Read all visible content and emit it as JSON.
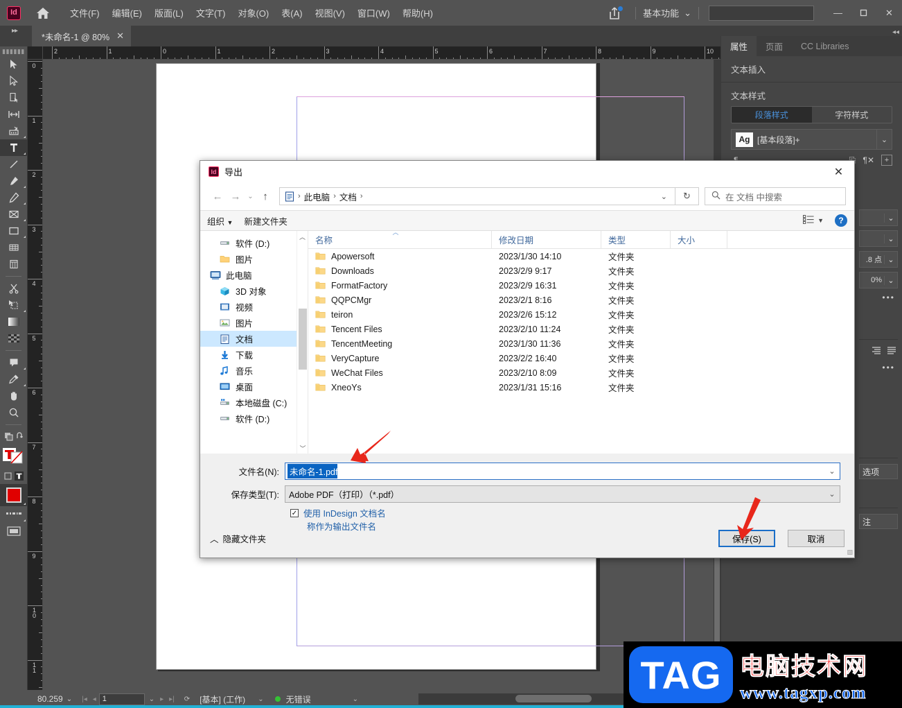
{
  "app": {
    "logo_text": "Id",
    "menus": [
      "文件(F)",
      "编辑(E)",
      "版面(L)",
      "文字(T)",
      "对象(O)",
      "表(A)",
      "视图(V)",
      "窗口(W)",
      "帮助(H)"
    ],
    "workspace": "基本功能",
    "window_controls": {
      "minimize": "—",
      "maximize": "❐",
      "close": "✕"
    },
    "tab": {
      "title": "*未命名-1 @ 80%",
      "close": "✕"
    }
  },
  "rulers": {
    "horizontal": [
      "2",
      "1",
      "0",
      "1",
      "2",
      "3",
      "4",
      "5",
      "6",
      "7",
      "8",
      "9",
      "10"
    ],
    "vertical": [
      "0",
      "1",
      "2",
      "3",
      "4",
      "5",
      "6",
      "7",
      "8",
      "9",
      "10",
      "11"
    ]
  },
  "right_dock": {
    "tabs": [
      {
        "label": "属性",
        "active": true
      },
      {
        "label": "页面",
        "active": false
      },
      {
        "label": "CC Libraries",
        "active": false
      }
    ],
    "section_text_insert": "文本插入",
    "section_text_style": "文本样式",
    "style_segments": [
      {
        "label": "段落样式",
        "active": true
      },
      {
        "label": "字符样式",
        "active": false
      }
    ],
    "style_swatch": "Ag",
    "style_name": "[基本段落]+",
    "stub_values": {
      "leading": ".8 点",
      "scale": "0%"
    },
    "stub_buttons": {
      "options": "选项",
      "notes": "注"
    },
    "dots": "•••"
  },
  "statusbar": {
    "zoom": "80.259",
    "page": "1",
    "master": "[基本]  (工作)",
    "errors": "无错误"
  },
  "dialog": {
    "title": "导出",
    "close": "✕",
    "nav": {
      "back": "←",
      "forward": "→",
      "recent": "⌄",
      "up": "↑"
    },
    "breadcrumbs": [
      "此电脑",
      "文档"
    ],
    "address_caret": "⌄",
    "refresh": "↻",
    "search_placeholder": "在 文档 中搜索",
    "commands": {
      "organize": "组织",
      "new_folder": "新建文件夹",
      "view": "▤",
      "help": "?"
    },
    "nav_pane": [
      {
        "label": "软件 (D:)",
        "icon": "drive-icon",
        "indent": "child",
        "active": false
      },
      {
        "label": "图片",
        "icon": "folder-icon",
        "indent": "child",
        "active": false
      },
      {
        "label": "此电脑",
        "icon": "pc-icon",
        "indent": "root",
        "active": false
      },
      {
        "label": "3D 对象",
        "icon": "cube-icon",
        "indent": "child",
        "active": false
      },
      {
        "label": "视频",
        "icon": "video-icon",
        "indent": "child",
        "active": false
      },
      {
        "label": "图片",
        "icon": "pictures-icon",
        "indent": "child",
        "active": false
      },
      {
        "label": "文档",
        "icon": "documents-icon",
        "indent": "child",
        "active": true
      },
      {
        "label": "下载",
        "icon": "download-icon",
        "indent": "child",
        "active": false
      },
      {
        "label": "音乐",
        "icon": "music-icon",
        "indent": "child",
        "active": false
      },
      {
        "label": "桌面",
        "icon": "desktop-icon",
        "indent": "child",
        "active": false
      },
      {
        "label": "本地磁盘 (C:)",
        "icon": "disk-icon",
        "indent": "child",
        "active": false
      },
      {
        "label": "软件 (D:)",
        "icon": "drive-icon",
        "indent": "child",
        "active": false
      }
    ],
    "columns": [
      "名称",
      "修改日期",
      "类型",
      "大小"
    ],
    "files": [
      {
        "name": "Apowersoft",
        "date": "2023/1/30 14:10",
        "type": "文件夹",
        "size": ""
      },
      {
        "name": "Downloads",
        "date": "2023/2/9 9:17",
        "type": "文件夹",
        "size": ""
      },
      {
        "name": "FormatFactory",
        "date": "2023/2/9 16:31",
        "type": "文件夹",
        "size": ""
      },
      {
        "name": "QQPCMgr",
        "date": "2023/2/1 8:16",
        "type": "文件夹",
        "size": ""
      },
      {
        "name": "teiron",
        "date": "2023/2/6 15:12",
        "type": "文件夹",
        "size": ""
      },
      {
        "name": "Tencent Files",
        "date": "2023/2/10 11:24",
        "type": "文件夹",
        "size": ""
      },
      {
        "name": "TencentMeeting",
        "date": "2023/1/30 11:36",
        "type": "文件夹",
        "size": ""
      },
      {
        "name": "VeryCapture",
        "date": "2023/2/2 16:40",
        "type": "文件夹",
        "size": ""
      },
      {
        "name": "WeChat Files",
        "date": "2023/2/10 8:09",
        "type": "文件夹",
        "size": ""
      },
      {
        "name": "XneoYs",
        "date": "2023/1/31 15:16",
        "type": "文件夹",
        "size": ""
      }
    ],
    "filename_label": "文件名(N):",
    "filename_value": "未命名-1.pdf",
    "filetype_label": "保存类型(T):",
    "filetype_value": "Adobe PDF（打印）（*.pdf）",
    "checkbox_checked": "✓",
    "checkbox_label_line1": "使用 InDesign 文档名",
    "checkbox_label_line2": "称作为输出文件名",
    "hide_folders": "隐藏文件夹",
    "hide_folders_caret": "︿",
    "save_button": "保存(S)",
    "cancel_button": "取消"
  },
  "watermark": {
    "badge": "TAG",
    "cn": "电脑技术网",
    "url": "www.tagxp.com"
  },
  "colors": {
    "accent_blue": "#1569f0",
    "dialog_bg": "#f0f0f0",
    "app_bg": "#535353",
    "arrow_red": "#e8271b",
    "selection_blue": "#0a64c2"
  }
}
